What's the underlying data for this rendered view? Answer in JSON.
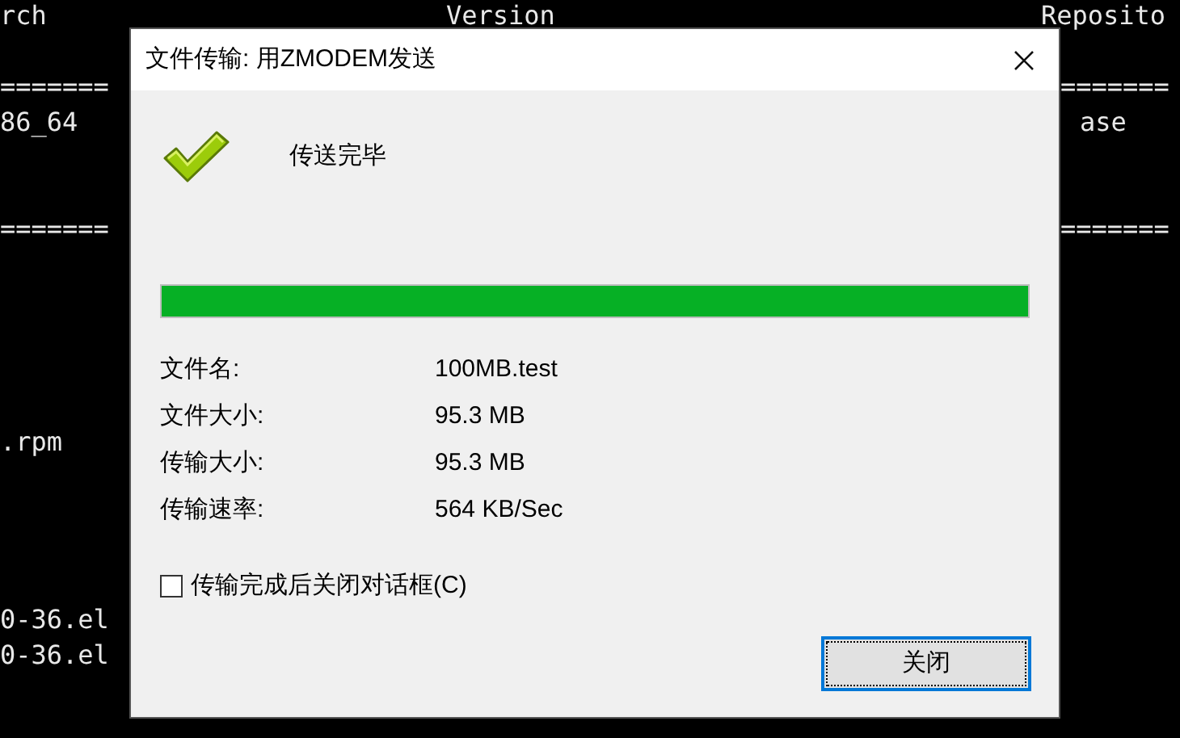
{
  "terminal": {
    "lines": [
      {
        "kind": "header",
        "left": "rch",
        "middle": "Version",
        "right": "Reposito"
      },
      {
        "kind": "blank"
      },
      {
        "kind": "rule",
        "left": "=======",
        "right": "======="
      },
      {
        "kind": "text",
        "left": "86_64",
        "right": "ase"
      },
      {
        "kind": "blank"
      },
      {
        "kind": "blank"
      },
      {
        "kind": "rule",
        "left": "=======",
        "right": "======="
      },
      {
        "kind": "blank"
      },
      {
        "kind": "blank"
      },
      {
        "kind": "blank"
      },
      {
        "kind": "blank"
      },
      {
        "kind": "blank"
      },
      {
        "kind": "text",
        "left": ".rpm"
      },
      {
        "kind": "blank"
      },
      {
        "kind": "blank"
      },
      {
        "kind": "blank"
      },
      {
        "kind": "blank"
      },
      {
        "kind": "text",
        "left": "0-36.el"
      },
      {
        "kind": "text",
        "left": "0-36.el"
      }
    ]
  },
  "dialog": {
    "title": "文件传输: 用ZMODEM发送",
    "status": "传送完毕",
    "progress": {
      "level": 1
    },
    "fields": [
      {
        "label": "文件名:",
        "value": "100MB.test"
      },
      {
        "label": "文件大小:",
        "value": "95.3 MB"
      },
      {
        "label": "传输大小:",
        "value": "95.3 MB"
      },
      {
        "label": "传输速率:",
        "value": "564 KB/Sec"
      }
    ],
    "close_option": {
      "label": "传输完成后关闭对话框(C)",
      "checked": false
    },
    "buttons": [
      {
        "label": "关闭",
        "focused": true
      }
    ]
  }
}
